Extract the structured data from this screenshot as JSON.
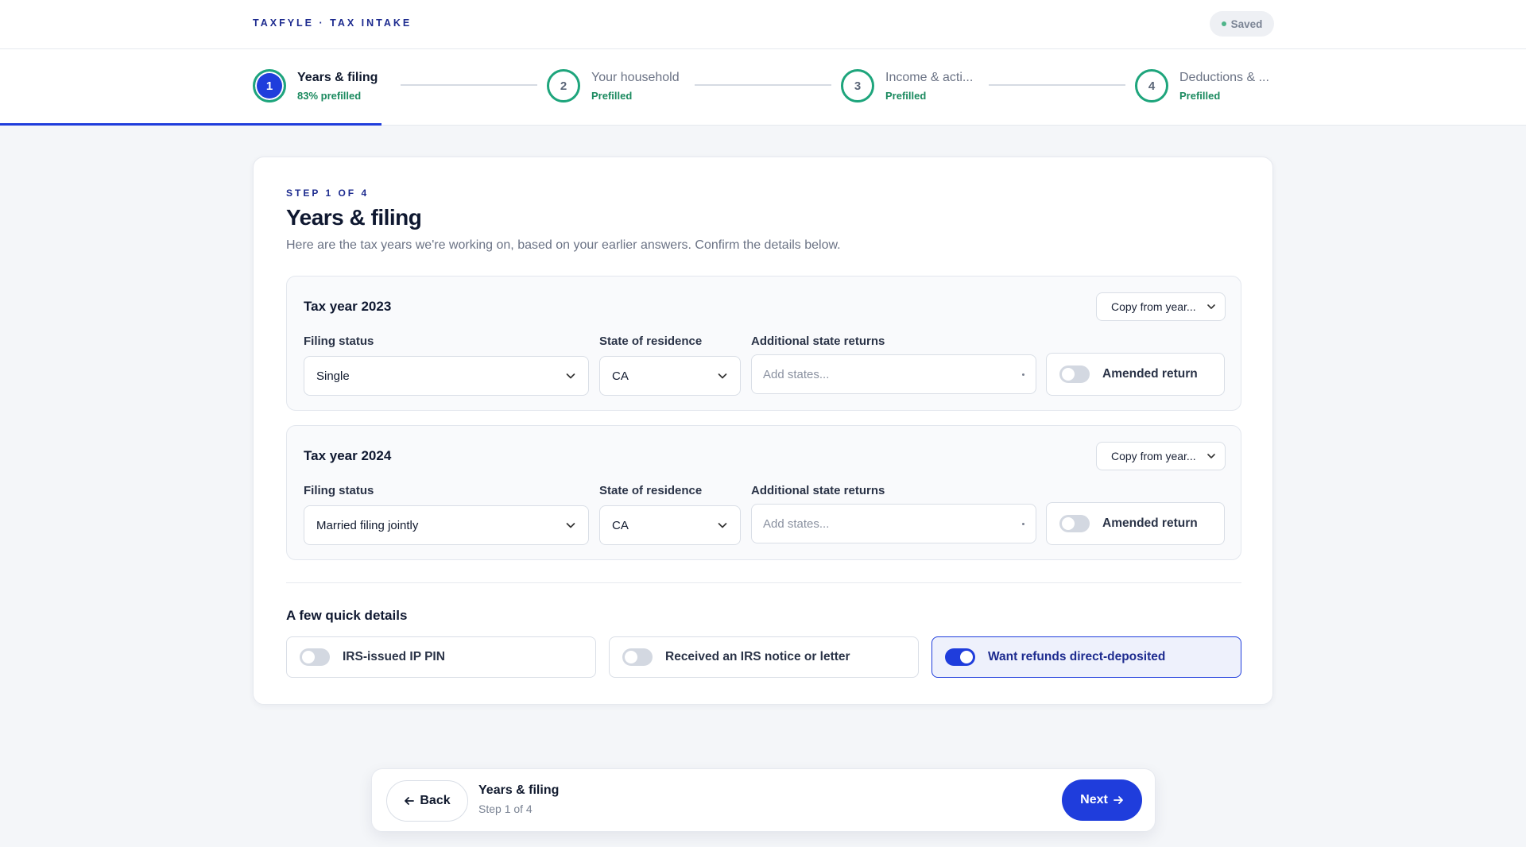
{
  "app": {
    "brand": "TAXFYLE · TAX INTAKE",
    "save_status": "Saved"
  },
  "stepper": {
    "steps": [
      {
        "number": "1",
        "title": "Years & filing",
        "status": "83% prefilled",
        "active": true
      },
      {
        "number": "2",
        "title": "Your household",
        "status": "Prefilled",
        "active": false
      },
      {
        "number": "3",
        "title": "Income & acti...",
        "status": "Prefilled",
        "active": false
      },
      {
        "number": "4",
        "title": "Deductions & ...",
        "status": "Prefilled",
        "active": false
      }
    ],
    "progress_fraction": 0.25
  },
  "main": {
    "eyebrow": "STEP 1 OF 4",
    "title": "Years & filing",
    "description": "Here are the tax years we're working on, based on your earlier answers. Confirm the details below.",
    "years": [
      {
        "title": "Tax year 2023",
        "copy_label": "Copy from year...",
        "filing_status_label": "Filing status",
        "filing_status_value": "Single",
        "state_label": "State of residence",
        "state_value": "CA",
        "additional_label": "Additional state returns",
        "additional_placeholder": "Add states...",
        "amended_label": "Amended return",
        "amended_on": false
      },
      {
        "title": "Tax year 2024",
        "copy_label": "Copy from year...",
        "filing_status_label": "Filing status",
        "filing_status_value": "Married filing jointly",
        "state_label": "State of residence",
        "state_value": "CA",
        "additional_label": "Additional state returns",
        "additional_placeholder": "Add states...",
        "amended_label": "Amended return",
        "amended_on": false
      }
    ],
    "quick_title": "A few quick details",
    "quick_options": [
      {
        "label": "IRS-issued IP PIN",
        "on": false
      },
      {
        "label": "Received an IRS notice or letter",
        "on": false
      },
      {
        "label": "Want refunds direct-deposited",
        "on": true
      }
    ]
  },
  "footer": {
    "back_label": "Back",
    "back_icon": "arrow-left-icon",
    "step_title": "Years & filing",
    "step_sub": "Step 1 of 4",
    "next_label": "Next",
    "next_icon": "arrow-right-icon"
  },
  "colors": {
    "accent": "#1f3ddc",
    "success": "#1ea57c",
    "brand_text": "#1d2b8f"
  }
}
